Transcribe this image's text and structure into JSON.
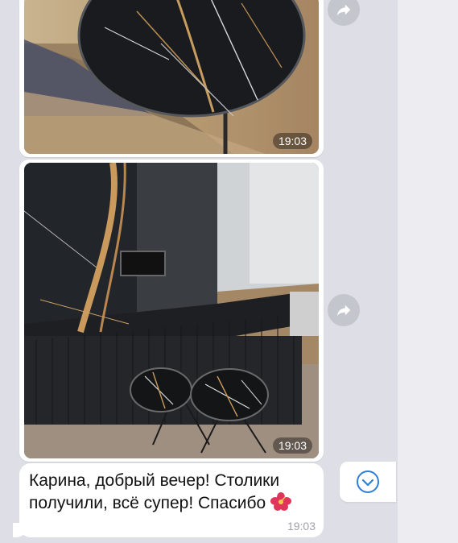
{
  "messages": [
    {
      "type": "photo",
      "time": "19:03"
    },
    {
      "type": "photo",
      "time": "19:03"
    },
    {
      "type": "text",
      "text": "Карина, добрый вечер! Столики получили, всё супер! Спасибо",
      "emoji": "hibiscus",
      "time": "19:03"
    }
  ],
  "icons": {
    "share": "share-arrow-icon",
    "scroll_down": "chevron-down-icon",
    "emoji": "hibiscus-icon"
  },
  "colors": {
    "accent": "#2f7fd6",
    "bubble": "#ffffff",
    "chat_background": "#dedfe6"
  }
}
